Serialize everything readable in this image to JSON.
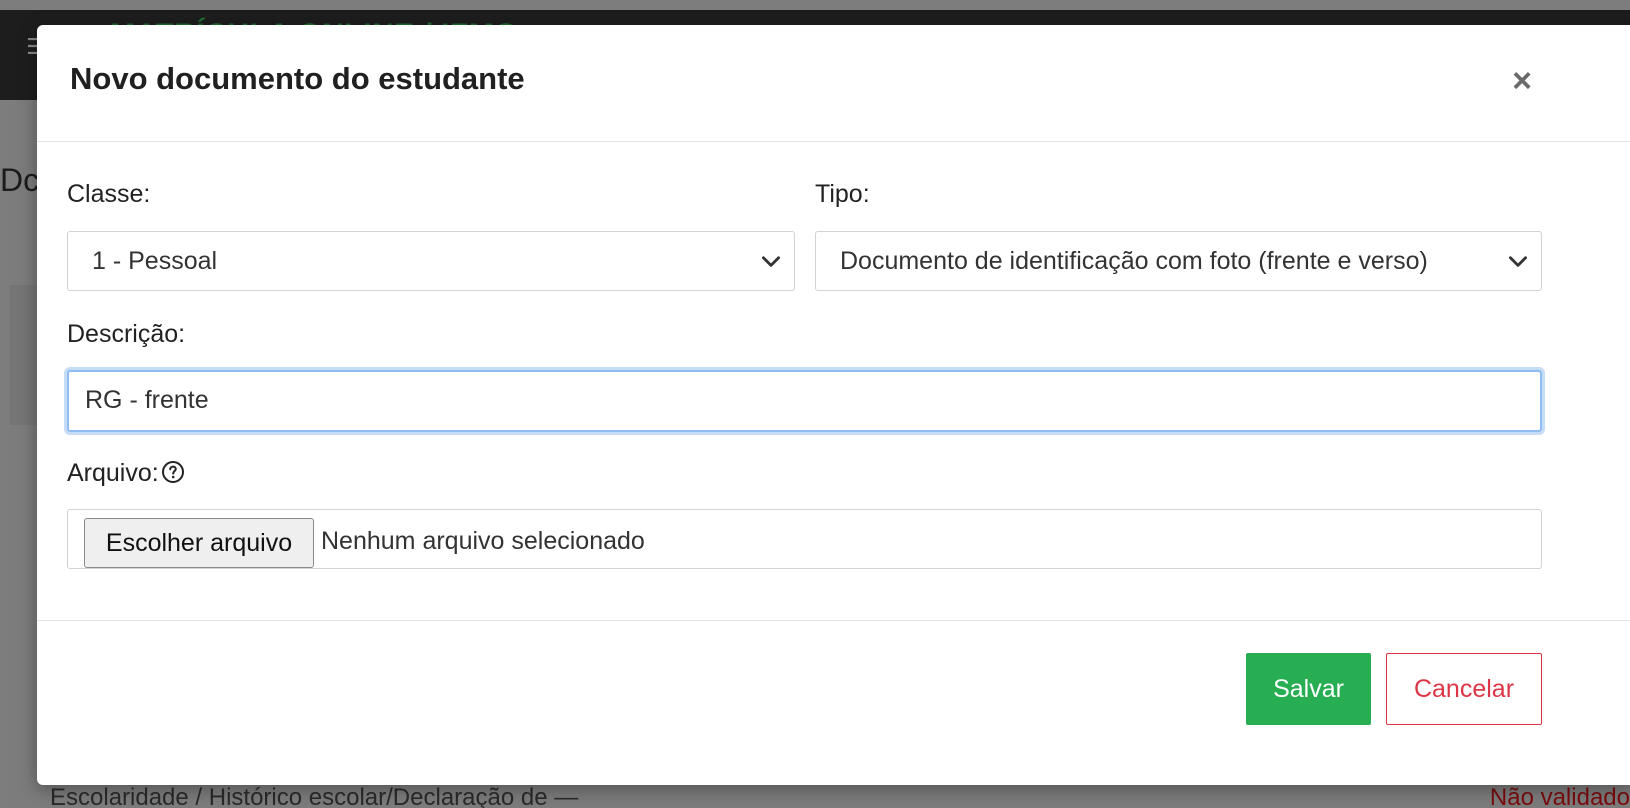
{
  "background": {
    "app_title": "MATRÍCULA ONLINE / IFMG",
    "heading_fragment": "Dc",
    "row_text": "Escolaridade / Histórico escolar/Declaração de   —",
    "row_status": "Não validado"
  },
  "modal": {
    "title": "Novo documento do estudante",
    "close_symbol": "×",
    "fields": {
      "classe": {
        "label": "Classe:",
        "value": "1 - Pessoal"
      },
      "tipo": {
        "label": "Tipo:",
        "value": "Documento de identificação com foto (frente e verso)"
      },
      "descricao": {
        "label": "Descrição:",
        "value": "RG - frente"
      },
      "arquivo": {
        "label": "Arquivo:",
        "help_icon": "question-circle-icon",
        "button_label": "Escolher arquivo",
        "status": "Nenhum arquivo selecionado"
      }
    },
    "buttons": {
      "save_label": "Salvar",
      "cancel_label": "Cancelar"
    }
  },
  "colors": {
    "save": "#27ae52",
    "cancel": "#dc3545",
    "focus_border": "#8fbdf2",
    "app_title": "#1f6e33",
    "status_invalid": "#7a0d0d"
  },
  "icons": {
    "menu": "hamburger-icon",
    "close": "close-icon",
    "select_arrow": "chevron-down-icon",
    "help": "question-circle-icon"
  }
}
